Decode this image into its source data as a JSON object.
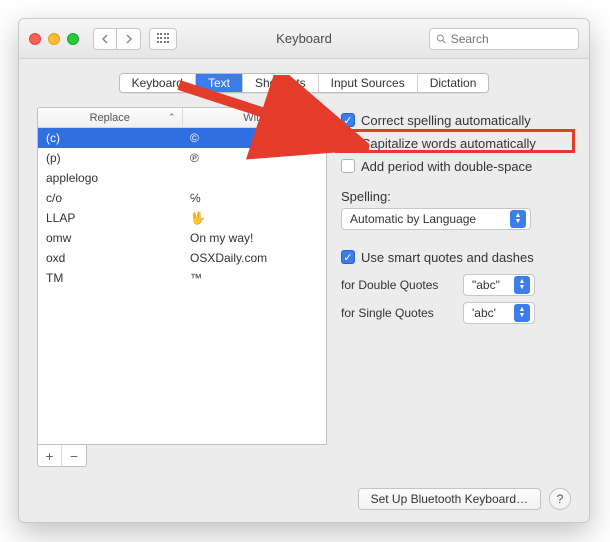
{
  "window": {
    "title": "Keyboard"
  },
  "search": {
    "placeholder": "Search"
  },
  "tabs": [
    "Keyboard",
    "Text",
    "Shortcuts",
    "Input Sources",
    "Dictation"
  ],
  "active_tab_index": 1,
  "table": {
    "headers": {
      "replace": "Replace",
      "with": "With"
    },
    "rows": [
      {
        "replace": "(c)",
        "with": "©",
        "selected": true
      },
      {
        "replace": "(p)",
        "with": "℗"
      },
      {
        "replace": "applelogo",
        "with": ""
      },
      {
        "replace": "c/o",
        "with": "℅"
      },
      {
        "replace": "LLAP",
        "with": "🖖"
      },
      {
        "replace": "omw",
        "with": "On my way!"
      },
      {
        "replace": "oxd",
        "with": "OSXDaily.com"
      },
      {
        "replace": "TM",
        "with": "™"
      }
    ]
  },
  "options": {
    "correct_spelling": {
      "label": "Correct spelling automatically",
      "checked": true
    },
    "capitalize": {
      "label": "Capitalize words automatically",
      "checked": false
    },
    "period_double_space": {
      "label": "Add period with double-space",
      "checked": false
    },
    "spelling_label": "Spelling:",
    "spelling_value": "Automatic by Language",
    "smart_quotes": {
      "label": "Use smart quotes and dashes",
      "checked": true
    },
    "double_quotes_label": "for Double Quotes",
    "double_quotes_value": "\"abc\"",
    "single_quotes_label": "for Single Quotes",
    "single_quotes_value": "'abc'"
  },
  "footer": {
    "bluetooth_btn": "Set Up Bluetooth Keyboard…",
    "help": "?"
  }
}
